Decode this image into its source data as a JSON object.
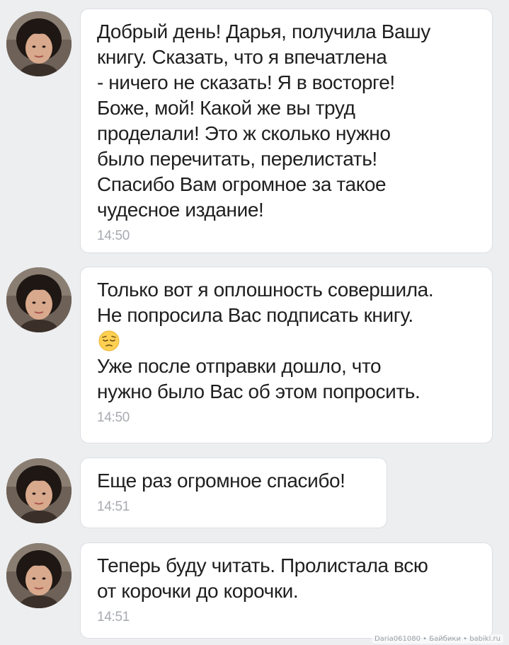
{
  "messages": [
    {
      "text": "Добрый день! Дарья, получила Вашу\nкнигу. Сказать, что я впечатлена\n- ничего не сказать! Я в восторге!\nБоже, мой! Какой же вы труд\nпроделали! Это ж сколько нужно\nбыло перечитать, перелистать!\nСпасибо Вам огромное за такое\nчудесное издание!",
      "time": "14:50"
    },
    {
      "text": "Только вот я оплошность совершила.\nНе попросила Вас подписать книгу.",
      "emoji": "pensive-face-emoji",
      "text2": "Уже после отправки дошло, что\nнужно было Вас об этом попросить.",
      "time": "14:50"
    },
    {
      "text": "Еще раз огромное спасибо!",
      "time": "14:51"
    },
    {
      "text": "Теперь буду читать. Пролистала всю\nот корочки до корочки.",
      "time": "14:51"
    }
  ],
  "watermark": "Daria061080 • Байбики • babiki.ru",
  "colors": {
    "background": "#edeef0",
    "bubble": "#ffffff",
    "time": "#a7aab0"
  }
}
